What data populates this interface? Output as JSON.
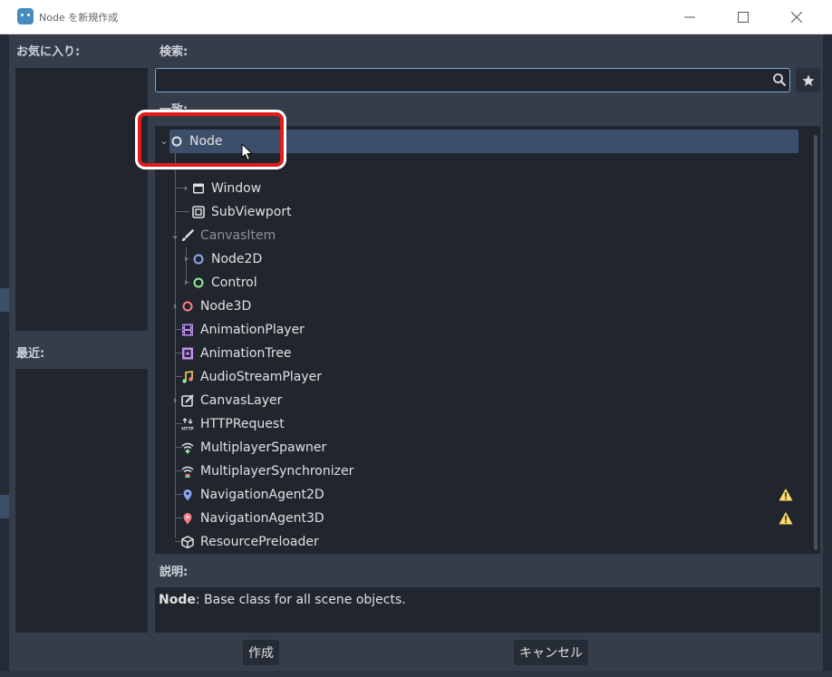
{
  "window": {
    "title": "Node を新規作成"
  },
  "labels": {
    "favorites": "お気に入り:",
    "recent": "最近:",
    "search": "検索:",
    "matches": "一致:",
    "description": "説明:"
  },
  "search": {
    "value": "",
    "placeholder": ""
  },
  "tree": [
    {
      "label": "Node",
      "icon": "node-circle-icon",
      "color": "#e0e0e0"
    },
    {
      "label": "Window",
      "icon": "window-icon",
      "color": "#e0e0e0"
    },
    {
      "label": "SubViewport",
      "icon": "subviewport-icon",
      "color": "#e0e0e0"
    },
    {
      "label": "CanvasItem",
      "icon": "brush-icon",
      "color": "#e0e0e0"
    },
    {
      "label": "Node2D",
      "icon": "node2d-circle-icon",
      "color": "#8da5f3"
    },
    {
      "label": "Control",
      "icon": "control-circle-icon",
      "color": "#8eef97"
    },
    {
      "label": "Node3D",
      "icon": "node3d-circle-icon",
      "color": "#fc7f7f"
    },
    {
      "label": "AnimationPlayer",
      "icon": "film-icon",
      "color": "#c38ef1"
    },
    {
      "label": "AnimationTree",
      "icon": "animation-tree-icon",
      "color": "#c38ef1"
    },
    {
      "label": "AudioStreamPlayer",
      "icon": "music-note-icon",
      "color": "#ffca5f"
    },
    {
      "label": "CanvasLayer",
      "icon": "canvas-layer-icon",
      "color": "#e0e0e0"
    },
    {
      "label": "HTTPRequest",
      "icon": "http-icon",
      "color": "#e0e0e0"
    },
    {
      "label": "MultiplayerSpawner",
      "icon": "wifi-plus-icon",
      "color": "#8eef97"
    },
    {
      "label": "MultiplayerSynchronizer",
      "icon": "wifi-sync-icon",
      "color": "#fc7f7f"
    },
    {
      "label": "NavigationAgent2D",
      "icon": "map-pin-2d-icon",
      "color": "#8da5f3"
    },
    {
      "label": "NavigationAgent3D",
      "icon": "map-pin-3d-icon",
      "color": "#fc7f7f"
    },
    {
      "label": "ResourcePreloader",
      "icon": "cube-icon",
      "color": "#e0e0e0"
    }
  ],
  "description": {
    "class_name": "Node",
    "text": ": Base class for all scene objects."
  },
  "buttons": {
    "create": "作成",
    "cancel": "キャンセル"
  },
  "colors": {
    "accent": "#6fa8dc",
    "highlight": "#e31b1b",
    "selection": "#3b4f6b",
    "warning": "#ffdd65"
  }
}
